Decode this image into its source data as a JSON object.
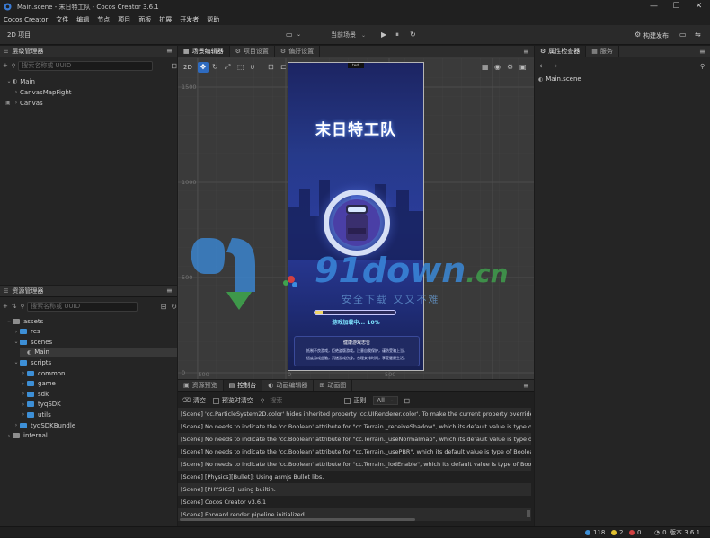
{
  "window": {
    "title": "Main.scene - 末日特工队 - Cocos Creator 3.6.1",
    "controls": {
      "minimize": "—",
      "maximize": "☐",
      "close": "✕"
    }
  },
  "menu": [
    "Cocos Creator",
    "文件",
    "编辑",
    "节点",
    "项目",
    "面板",
    "扩展",
    "开发者",
    "帮助"
  ],
  "toolbar": {
    "mode_label": "2D 项目",
    "scene_select": "当前场景",
    "build_label": "构建发布"
  },
  "hierarchy": {
    "title": "层级管理器",
    "search_placeholder": "搜索名称或 UUID",
    "items": [
      {
        "label": "Main",
        "depth": 0,
        "arrow": "⌄"
      },
      {
        "label": "CanvasMapFight",
        "depth": 1,
        "arrow": "›"
      },
      {
        "label": "Canvas",
        "depth": 0,
        "arrow": "›"
      }
    ]
  },
  "assets": {
    "title": "资源管理器",
    "search_placeholder": "搜索名称或 UUID",
    "items": [
      {
        "label": "assets",
        "kind": "folder-gray",
        "arrow": "⌄"
      },
      {
        "label": "res",
        "kind": "folder",
        "arrow": "›"
      },
      {
        "label": "scenes",
        "kind": "folder",
        "arrow": "⌄"
      },
      {
        "label": "Main",
        "kind": "scene",
        "arrow": ""
      },
      {
        "label": "scripts",
        "kind": "folder",
        "arrow": "⌄"
      },
      {
        "label": "common",
        "kind": "folder",
        "arrow": "›"
      },
      {
        "label": "game",
        "kind": "folder",
        "arrow": "›"
      },
      {
        "label": "sdk",
        "kind": "folder",
        "arrow": "›"
      },
      {
        "label": "tyqSDK",
        "kind": "folder",
        "arrow": "›"
      },
      {
        "label": "utils",
        "kind": "folder",
        "arrow": "›"
      },
      {
        "label": "tyqSDKBundle",
        "kind": "folder",
        "arrow": "›"
      },
      {
        "label": "internal",
        "kind": "folder-gray",
        "arrow": "›"
      }
    ]
  },
  "scene": {
    "tabs": [
      "场景编辑器",
      "项目设置",
      "偏好设置"
    ],
    "mode": "2D",
    "ruler_left": [
      "1500",
      "1000",
      "500",
      "0"
    ],
    "ruler_bottom": [
      "-500",
      "0",
      "500"
    ],
    "preview_label": "test",
    "game": {
      "title": "末日特工队",
      "loading_text": "游戏加载中... 10%",
      "loading_progress": 0.1,
      "notice_title": "健康游戏忠告",
      "notice_lines": [
        "抵制不良游戏，拒绝盗版游戏。注意自我保护，谨防受骗上当。",
        "适度游戏益脑，沉迷游戏伤身。合理安排时间，享受健康生活。"
      ]
    }
  },
  "inspector": {
    "tabs": [
      "属性检查器",
      "服务"
    ],
    "current": "Main.scene"
  },
  "console": {
    "tabs": [
      "资源预览",
      "控制台",
      "动画编辑器",
      "动画图"
    ],
    "active_tab": "控制台",
    "clear_label": "清空",
    "preview_clear_label": "预览时清空",
    "search_placeholder": "搜索",
    "regex_label": "正则",
    "level_select": "All",
    "logs": [
      "[Scene] 'cc.ParticleSystem2D.color' hides inherited property 'cc.UIRenderer.color'. To make the current property override that i",
      "[Scene] No needs to indicate the 'cc.Boolean' attribute for \"cc.Terrain._receiveShadow\", which its default value is type of Boolea",
      "[Scene] No needs to indicate the 'cc.Boolean' attribute for \"cc.Terrain._useNormalmap\", which its default value is type of Boolea",
      "[Scene] No needs to indicate the 'cc.Boolean' attribute for \"cc.Terrain._usePBR\", which its default value is type of Boolean.",
      "[Scene] No needs to indicate the 'cc.Boolean' attribute for \"cc.Terrain._lodEnable\", which its default value is type of Boolean.",
      "[Scene] [Physics][Bullet]: Using asmjs Bullet libs.",
      "[Scene] [PHYSICS]: using builtin.",
      "[Scene] Cocos Creator v3.6.1",
      "[Scene] Forward render pipeline initialized."
    ]
  },
  "status": {
    "info_count": "118",
    "warn_count": "2",
    "error_count": "0",
    "notify_count": "0",
    "version_label": "版本 3.6.1"
  },
  "watermark": {
    "brand": "91down",
    "suffix": ".cn",
    "tagline": "安全下载 又又不难"
  },
  "colors": {
    "accent": "#3d8fd6",
    "editor_bg": "#252525",
    "scene_bg": "#3a3a3a",
    "game_bg": "#1f2a6b"
  }
}
